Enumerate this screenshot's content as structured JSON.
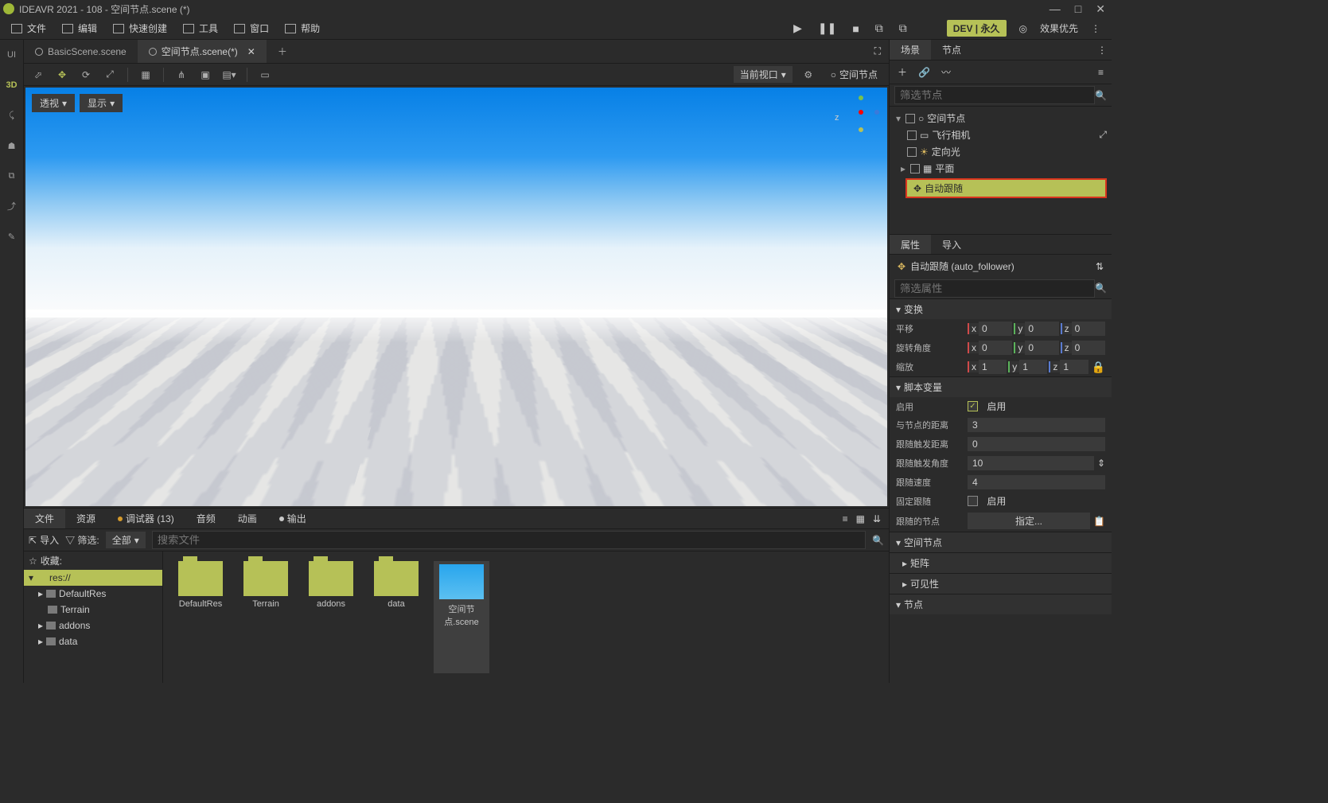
{
  "title": "IDEAVR 2021 - 108 - 空间节点.scene (*)",
  "window_controls": {
    "min": "—",
    "max": "□",
    "close": "✕"
  },
  "menu": [
    {
      "icon": "file",
      "label": "文件"
    },
    {
      "icon": "edit",
      "label": "编辑"
    },
    {
      "icon": "quick",
      "label": "快速创建"
    },
    {
      "icon": "tools",
      "label": "工具"
    },
    {
      "icon": "window",
      "label": "窗口"
    },
    {
      "icon": "help",
      "label": "帮助"
    }
  ],
  "playback_icons": [
    "▶",
    "❚❚",
    "■",
    "⧉",
    "⧉"
  ],
  "dev_badge": "DEV | 永久",
  "menu_right": {
    "grad": "◎",
    "opt": "效果优先"
  },
  "left_rail": [
    "UI",
    "3D",
    "⤹",
    "☗",
    "⧉",
    "⤴",
    "✎"
  ],
  "scene_tabs": [
    {
      "label": "BasicScene.scene",
      "active": false,
      "closable": false
    },
    {
      "label": "空间节点.scene(*)",
      "active": true,
      "closable": true
    }
  ],
  "viewport_top": {
    "btn1": "透视",
    "btn2": "显示"
  },
  "tbar_right": {
    "viewport_label": "当前视口",
    "scene_root": "空间节点"
  },
  "bottom_tabs": [
    {
      "label": "文件",
      "active": true
    },
    {
      "label": "资源"
    },
    {
      "label": "调试器 (13)",
      "dot": "#d59a2b"
    },
    {
      "label": "音频"
    },
    {
      "label": "动画"
    },
    {
      "label": "输出",
      "dot": "#c9c9c9"
    }
  ],
  "bfilter": {
    "import": "导入",
    "filter_label": "筛选:",
    "all": "全部",
    "search_placeholder": "搜索文件"
  },
  "ftree": [
    {
      "label": "收藏:",
      "fav": true,
      "indent": 0
    },
    {
      "label": "res://",
      "sel": true,
      "indent": 0
    },
    {
      "label": "DefaultRes",
      "indent": 1,
      "exp": true
    },
    {
      "label": "Terrain",
      "indent": 2
    },
    {
      "label": "addons",
      "indent": 1,
      "exp": true
    },
    {
      "label": "data",
      "indent": 1,
      "exp": true
    }
  ],
  "fgrid": [
    {
      "name": "DefaultRes",
      "type": "folder"
    },
    {
      "name": "Terrain",
      "type": "folder"
    },
    {
      "name": "addons",
      "type": "folder"
    },
    {
      "name": "data",
      "type": "folder"
    },
    {
      "name": "空间节点.scene",
      "type": "scene",
      "sel": true
    }
  ],
  "right_tabs": [
    {
      "label": "场景",
      "active": true
    },
    {
      "label": "节点"
    }
  ],
  "scene_filter_placeholder": "筛选节点",
  "scene_tree": [
    {
      "indent": 0,
      "exp": "▾",
      "icon": "○",
      "label": "空间节点"
    },
    {
      "indent": 1,
      "icon": "▭",
      "label": "飞行相机",
      "extra": "⤢"
    },
    {
      "indent": 1,
      "icon": "☀",
      "label": "定向光"
    },
    {
      "indent": 1,
      "exp": "▸",
      "icon": "▦",
      "label": "平面"
    },
    {
      "indent": 1,
      "icon": "✥",
      "label": "自动跟随",
      "hl": true
    }
  ],
  "prop_tabs": [
    {
      "label": "属性",
      "active": true
    },
    {
      "label": "导入"
    }
  ],
  "prop_header": "自动跟随 (auto_follower)",
  "prop_filter_placeholder": "筛选属性",
  "sections": {
    "transform": "变换",
    "translate": "平移",
    "rotate": "旋转角度",
    "scale": "缩放",
    "script_vars": "脚本变量",
    "enable": "启用",
    "enable_label": "启用",
    "enable_on": true,
    "distance": "与节点的距离",
    "distance_v": "3",
    "follow_trigger_dist": "跟随触发距离",
    "follow_trigger_dist_v": "0",
    "follow_trigger_angle": "跟随触发角度",
    "follow_trigger_angle_v": "10",
    "follow_speed": "跟随速度",
    "follow_speed_v": "4",
    "fixed_follow": "固定跟随",
    "fixed_enable": "启用",
    "fixed_on": false,
    "follow_node": "跟随的节点",
    "assign": "指定...",
    "spatial": "空间节点",
    "matrix": "矩阵",
    "visibility": "可见性",
    "node": "节点"
  },
  "xyz": {
    "x": "x",
    "y": "y",
    "z": "z"
  },
  "vals": {
    "zero": "0",
    "one": "1"
  }
}
